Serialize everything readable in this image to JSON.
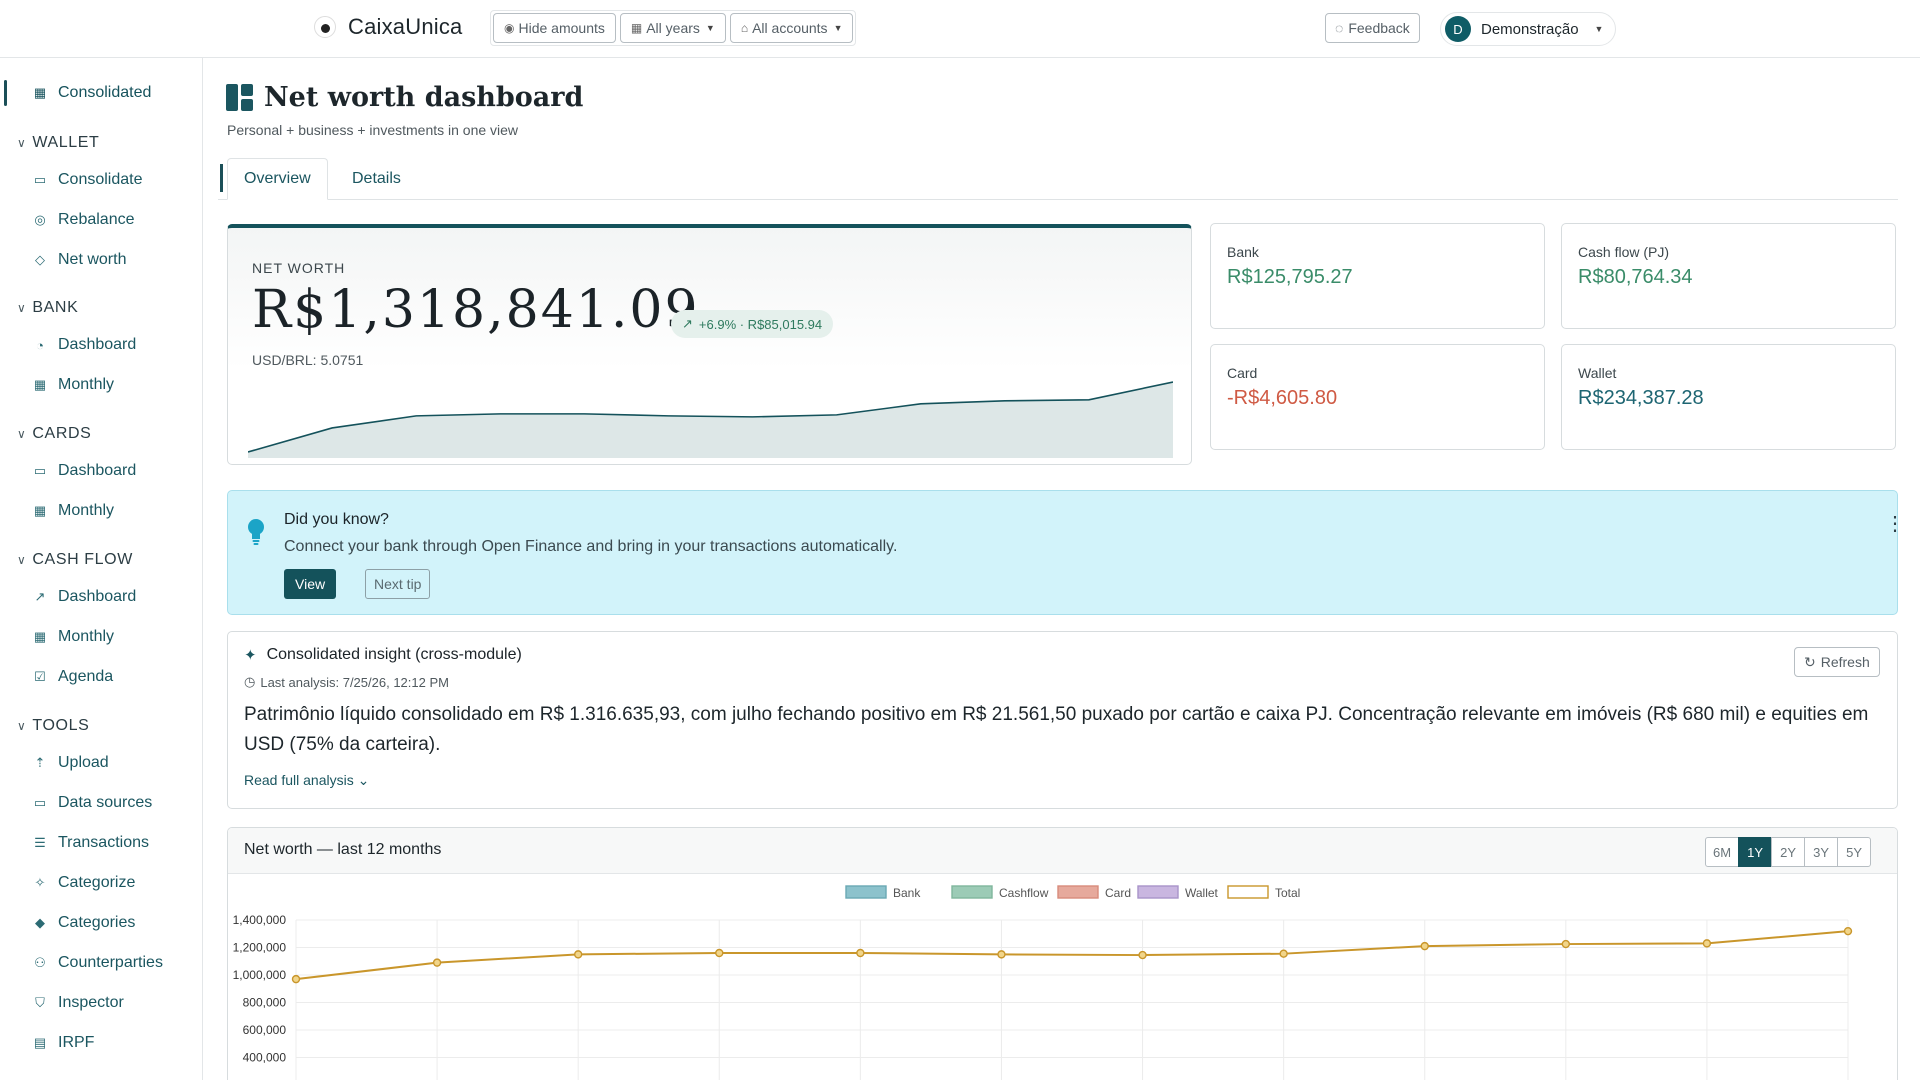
{
  "header": {
    "brand": "CaixaUnica",
    "filters": [
      {
        "label": "Hide amounts",
        "icon": "eye-icon"
      },
      {
        "label": "All years",
        "icon": "calendar-icon"
      },
      {
        "label": "All accounts",
        "icon": "bank-icon"
      }
    ],
    "feedback_label": "Feedback",
    "user": {
      "initial": "D",
      "name": "Demonstração"
    }
  },
  "sidebar": {
    "top_item": {
      "label": "Consolidated",
      "icon": "grid-icon"
    },
    "sections": [
      {
        "title": "WALLET",
        "items": [
          {
            "label": "Consolidate",
            "icon": "wallet-icon"
          },
          {
            "label": "Rebalance",
            "icon": "target-icon"
          },
          {
            "label": "Net worth",
            "icon": "tag-icon"
          }
        ]
      },
      {
        "title": "BANK",
        "items": [
          {
            "label": "Dashboard",
            "icon": "gauge-icon"
          },
          {
            "label": "Monthly",
            "icon": "calendar-icon"
          }
        ]
      },
      {
        "title": "CARDS",
        "items": [
          {
            "label": "Dashboard",
            "icon": "card-icon"
          },
          {
            "label": "Monthly",
            "icon": "calendar-icon"
          }
        ]
      },
      {
        "title": "CASH FLOW",
        "items": [
          {
            "label": "Dashboard",
            "icon": "chart-line-icon"
          },
          {
            "label": "Monthly",
            "icon": "calendar-icon"
          },
          {
            "label": "Agenda",
            "icon": "calendar-check-icon"
          }
        ]
      },
      {
        "title": "TOOLS",
        "items": [
          {
            "label": "Upload",
            "icon": "upload-icon"
          },
          {
            "label": "Data sources",
            "icon": "folder-icon"
          },
          {
            "label": "Transactions",
            "icon": "list-icon"
          },
          {
            "label": "Categorize",
            "icon": "wand-icon"
          },
          {
            "label": "Categories",
            "icon": "tags-icon"
          },
          {
            "label": "Counterparties",
            "icon": "people-icon"
          },
          {
            "label": "Inspector",
            "icon": "shield-icon"
          },
          {
            "label": "IRPF",
            "icon": "document-icon"
          }
        ]
      }
    ]
  },
  "page": {
    "title": "Net worth dashboard",
    "subtitle": "Personal + business + investments in one view",
    "tabs": [
      "Overview",
      "Details"
    ]
  },
  "net_worth": {
    "label": "NET WORTH",
    "value": "R$1,318,841.09",
    "delta": "+6.9% · R$85,015.94",
    "fx": "USD/BRL: 5.0751"
  },
  "stats": [
    {
      "label": "Bank",
      "value": "R$125,795.27",
      "tone": "pos"
    },
    {
      "label": "Cash flow (PJ)",
      "value": "R$80,764.34",
      "tone": "pos"
    },
    {
      "label": "Card",
      "value": "-R$4,605.80",
      "tone": "neg"
    },
    {
      "label": "Wallet",
      "value": "R$234,387.28",
      "tone": "teal"
    }
  ],
  "tip": {
    "title": "Did you know?",
    "text": "Connect your bank through Open Finance and bring in your transactions automatically.",
    "view_label": "View",
    "next_label": "Next tip"
  },
  "insight": {
    "title": "Consolidated insight (cross-module)",
    "last_analysis": "Last analysis: 7/25/26, 12:12 PM",
    "body": "Patrimônio líquido consolidado em R$ 1.316.635,93, com julho fechando positivo em R$ 21.561,50 puxado por cartão e caixa PJ. Concentração relevante em imóveis (R$ 680 mil) e equities em USD (75% da carteira).",
    "read_more": "Read full analysis",
    "refresh_label": "Refresh"
  },
  "colors": {
    "accent": "#14525b",
    "positive": "#3a8c69",
    "negative": "#cf5a44",
    "total_line": "#c9962b"
  },
  "chart_data": {
    "type": "line",
    "title": "Net worth — last 12 months",
    "ranges": [
      "6M",
      "1Y",
      "2Y",
      "3Y",
      "5Y"
    ],
    "active_range": "1Y",
    "legend": [
      "Bank",
      "Cashflow",
      "Card",
      "Wallet",
      "Total"
    ],
    "legend_placement": "top-center",
    "y_ticks": [
      "1,400,000",
      "1,200,000",
      "1,000,000",
      "800,000",
      "600,000",
      "400,000"
    ],
    "ylim": [
      400000,
      1400000
    ],
    "grid": true,
    "series": [
      {
        "name": "Total",
        "values": [
          970000,
          1090000,
          1150000,
          1160000,
          1160000,
          1150000,
          1145000,
          1155000,
          1210000,
          1225000,
          1230000,
          1318841
        ]
      }
    ]
  }
}
